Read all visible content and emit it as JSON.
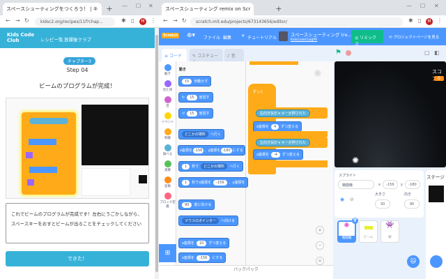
{
  "left_window": {
    "tab_title": "スペースシューティングをつくろう！ | キ",
    "url": "kidsc2.org/recipes/11f?chap...",
    "site": {
      "logo": "Kids Code Club",
      "nav": [
        "レシピ一覧",
        "放課後クラブ"
      ]
    },
    "chapter_badge": "チャプター3",
    "step": "Step 04",
    "heading": "ビームのプログラムが完成！",
    "description": "これでビームのプログラムが完成です！左右にうごかしながら、スペースキーをおすとビームが出ることをチェックしてください",
    "done_button": "できた！"
  },
  "right_window": {
    "tab_title": "スペースシューティング remix on Scr",
    "url": "scratch.mit.edu/projects/673143656/editor/",
    "menu": {
      "logo": "Scratch",
      "file": "ファイル",
      "edit": "編集",
      "tutorial": "チュートリアル",
      "project_title": "スペースシューティング (re...",
      "author": "KidsCodeClubJPR",
      "remix": "リミックス",
      "project_page": "プロジェクトページを見る"
    },
    "editor_tabs": [
      "コード",
      "コスチューム",
      "音"
    ],
    "categories": [
      {
        "label": "動き",
        "color": "#4c97ff"
      },
      {
        "label": "見た目",
        "color": "#9966ff"
      },
      {
        "label": "音",
        "color": "#cf63cf"
      },
      {
        "label": "イベント",
        "color": "#ffd500"
      },
      {
        "label": "制御",
        "color": "#ffab19"
      },
      {
        "label": "調べる",
        "color": "#5cb1d6"
      },
      {
        "label": "演算",
        "color": "#59c059"
      },
      {
        "label": "変数",
        "color": "#ff8c1a"
      },
      {
        "label": "ブロック定義",
        "color": "#ff6680"
      }
    ],
    "palette_heading": "動き",
    "palette": {
      "move": [
        "15",
        "歩動かす"
      ],
      "turn_right": [
        "15",
        "度回す"
      ],
      "turn_left": [
        "15",
        "度回す"
      ],
      "goto": [
        "どこかの場所",
        "へ行く"
      ],
      "goto_xy": [
        "x座標を",
        "-156",
        "、y座標を",
        "-180",
        "にする"
      ],
      "glide": [
        "1",
        "秒で",
        "どこかの場所",
        "へ行く"
      ],
      "glide_xy": [
        "1",
        "秒でx座標を",
        "-156",
        "、y座標を"
      ],
      "point": [
        "90",
        "度に向ける"
      ],
      "point_towards": [
        "マウスのポインター",
        "へ向ける"
      ],
      "change_x": [
        "x座標を",
        "10",
        "ずつ変える"
      ],
      "set_x": [
        "x座標を",
        "-156",
        "にする"
      ]
    },
    "script": {
      "forever": "ずっと",
      "if1": [
        "もし",
        "右向き矢印",
        "キーが押された",
        "なら"
      ],
      "change1": [
        "x座標を",
        "4",
        "ずつ変える"
      ],
      "if2": [
        "もし",
        "左向き矢印",
        "キーが押された",
        "なら"
      ],
      "change2": [
        "x座標を",
        "-4",
        "ずつ変える"
      ]
    },
    "backpack": "バックパック",
    "stage": {
      "score_label": "スコア",
      "score_value": "0"
    },
    "sprite_info": {
      "label": "スプライト",
      "name": "戦闘機",
      "x_label": "x",
      "x": "-156",
      "y_label": "y",
      "y": "-180",
      "size_label": "大きさ",
      "size": "30",
      "direction_label": "向き",
      "direction": "90"
    },
    "sprites": [
      "戦闘機",
      "ビーム",
      "敵"
    ],
    "stage_label": "ステージ"
  }
}
